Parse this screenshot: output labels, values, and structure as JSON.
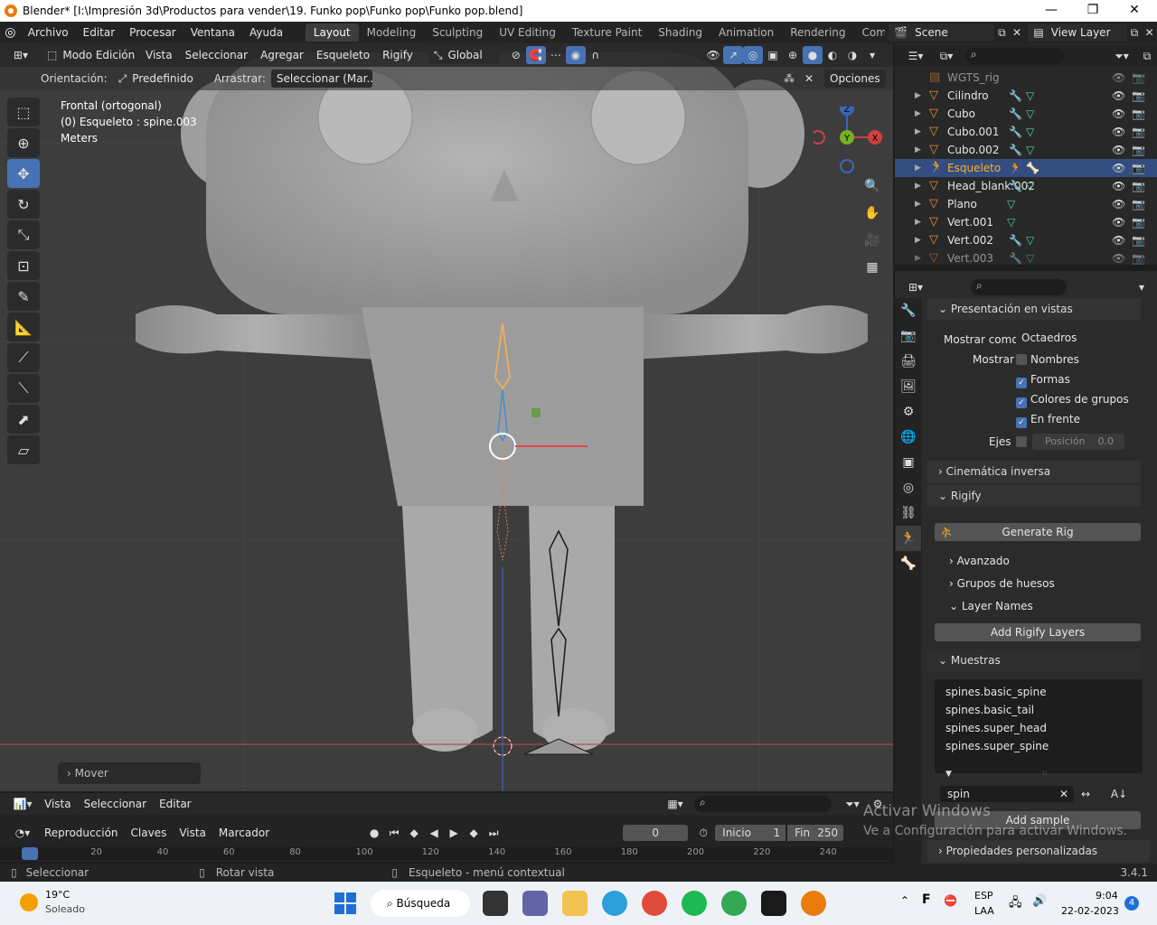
{
  "window": {
    "title": "Blender* [I:\\Impresión 3d\\Productos para vender\\19. Funko pop\\Funko pop\\Funko pop.blend]",
    "minimize": "—",
    "maximize": "❐",
    "close": "✕"
  },
  "menubar": {
    "items": [
      "Archivo",
      "Editar",
      "Procesar",
      "Ventana",
      "Ayuda"
    ]
  },
  "workspaces": {
    "tabs": [
      "Layout",
      "Modeling",
      "Sculpting",
      "UV Editing",
      "Texture Paint",
      "Shading",
      "Animation",
      "Rendering",
      "Compo"
    ],
    "active": "Layout"
  },
  "scene": {
    "name": "Scene",
    "view_layer": "View Layer"
  },
  "viewport": {
    "header": {
      "mode": "Modo Edición",
      "menus": [
        "Vista",
        "Seleccionar",
        "Agregar",
        "Esqueleto",
        "Rigify"
      ],
      "transform": "Global"
    },
    "header2": {
      "orient_label": "Orientación:",
      "orient_value": "Predefinido",
      "drag_label": "Arrastrar:",
      "drag_value": "Seleccionar (Mar...",
      "options": "Opciones"
    },
    "info": {
      "view": "Frontal (ortogonal)",
      "object": "(0) Esqueleto : spine.003",
      "units": "Meters"
    },
    "gizmo": {
      "z": "Z",
      "y": "Y",
      "x": "X"
    },
    "last_operator": "Mover"
  },
  "outliner": {
    "rows": [
      {
        "name": "WGTS_rig",
        "icon": "collection-icon",
        "mods": "",
        "data": "",
        "dim": true,
        "partial": true
      },
      {
        "name": "Cilindro",
        "icon": "mesh-icon",
        "mods": "🔧",
        "data": "▽"
      },
      {
        "name": "Cubo",
        "icon": "mesh-icon",
        "mods": "🔧",
        "data": "▽"
      },
      {
        "name": "Cubo.001",
        "icon": "mesh-icon",
        "mods": "🔧",
        "data": "▽"
      },
      {
        "name": "Cubo.002",
        "icon": "mesh-icon",
        "mods": "🔧",
        "data": "▽"
      },
      {
        "name": "Esqueleto",
        "icon": "armature-icon",
        "mods": "🏃",
        "data": "🦴",
        "selected": true
      },
      {
        "name": "Head_blank.002",
        "icon": "mesh-icon",
        "mods": "🔧",
        "data": "▽"
      },
      {
        "name": "Plano",
        "icon": "mesh-icon",
        "mods": "",
        "data": "▽"
      },
      {
        "name": "Vert.001",
        "icon": "mesh-icon",
        "mods": "",
        "data": "▽"
      },
      {
        "name": "Vert.002",
        "icon": "mesh-icon",
        "mods": "🔧",
        "data": "▽"
      },
      {
        "name": "Vert.003",
        "icon": "mesh-icon",
        "mods": "🔧",
        "data": "▽",
        "dim": true
      }
    ]
  },
  "properties": {
    "viewport_display": {
      "title": "Presentación en vistas",
      "show_as_label": "Mostrar como",
      "show_as_value": "Octaedros",
      "show_label": "Mostrar",
      "names": "Nombres",
      "shapes": "Formas",
      "group_colors": "Colores de grupos",
      "in_front": "En frente",
      "axes_label": "Ejes",
      "position_label": "Posición",
      "position_value": "0.0"
    },
    "ik_title": "Cinemática inversa",
    "rigify": {
      "title": "Rigify",
      "generate": "Generate Rig",
      "advanced": "Avanzado",
      "bone_groups": "Grupos de huesos",
      "layer_names": "Layer Names",
      "add_layers": "Add Rigify Layers",
      "samples_title": "Muestras",
      "samples": [
        "spines.basic_spine",
        "spines.basic_tail",
        "spines.super_head",
        "spines.super_spine"
      ],
      "filter": "spin",
      "add_sample": "Add sample"
    },
    "custom_props": "Propiedades personalizadas"
  },
  "timeline": {
    "header": [
      "Vista",
      "Seleccionar",
      "Editar"
    ],
    "playback": "Reproducción",
    "keys": "Claves",
    "view": "Vista",
    "marker": "Marcador",
    "current_frame": "0",
    "start_label": "Inicio",
    "start": "1",
    "end_label": "Fin",
    "end": "250",
    "ruler": [
      "0",
      "20",
      "40",
      "60",
      "80",
      "100",
      "120",
      "140",
      "160",
      "180",
      "200",
      "220",
      "240"
    ]
  },
  "statusbar": {
    "select": "Seleccionar",
    "rotate": "Rotar vista",
    "context": "Esqueleto - menú contextual",
    "version": "3.4.1"
  },
  "watermark": {
    "line1": "Activar Windows",
    "line2": "Ve a Configuración para activar Windows."
  },
  "taskbar": {
    "weather_temp": "19°C",
    "weather_text": "Soleado",
    "search": "Búsqueda",
    "lang1": "ESP",
    "lang2": "LAA",
    "time": "9:04",
    "date": "22-02-2023",
    "badge": "4"
  },
  "colors": {
    "accent": "#4772b3",
    "selection": "#ffaf29",
    "viewport_bg": "#3d3d3d",
    "panel_bg": "#2b2b2b"
  }
}
